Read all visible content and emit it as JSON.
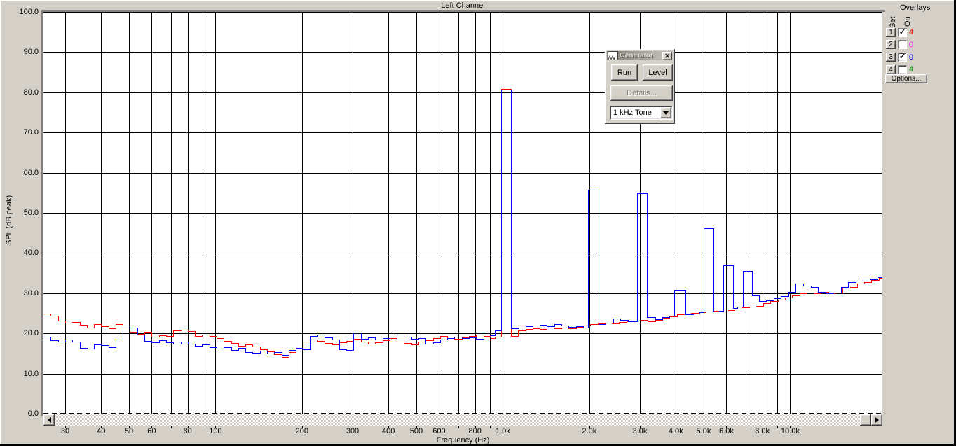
{
  "window": {
    "app_context": "audio spectrum analyzer"
  },
  "chart": {
    "title": "Left Channel",
    "xlabel": "Frequency (Hz)",
    "ylabel": "SPL (dB peak)"
  },
  "chart_data": {
    "type": "line",
    "subtype": "stepped-spectrum",
    "title": "Left Channel",
    "xlabel": "Frequency (Hz)",
    "ylabel": "SPL (dB peak)",
    "x_scale": "log",
    "x_range_hz": [
      25.2,
      20940
    ],
    "ylim": [
      0,
      100
    ],
    "grid": true,
    "grid_color": "#000000",
    "y_ticks": [
      {
        "v": 100,
        "label": "100.0"
      },
      {
        "v": 90,
        "label": "90.0"
      },
      {
        "v": 80,
        "label": "80.0"
      },
      {
        "v": 70,
        "label": "70.0"
      },
      {
        "v": 60,
        "label": "60.0"
      },
      {
        "v": 50,
        "label": "50.0"
      },
      {
        "v": 40,
        "label": "40.0"
      },
      {
        "v": 30,
        "label": "30.0"
      },
      {
        "v": 20,
        "label": "20.0"
      },
      {
        "v": 10,
        "label": "10.0"
      },
      {
        "v": 0,
        "label": "0.0"
      }
    ],
    "grid_freqs": [
      30,
      40,
      50,
      60,
      70,
      80,
      90,
      100,
      200,
      300,
      400,
      500,
      600,
      700,
      800,
      900,
      1000,
      2000,
      3000,
      4000,
      5000,
      6000,
      7000,
      8000,
      9000,
      10000
    ],
    "x_tick_labels": [
      {
        "f": 30,
        "label": "30"
      },
      {
        "f": 40,
        "label": "40"
      },
      {
        "f": 50,
        "label": "50"
      },
      {
        "f": 60,
        "label": "60"
      },
      {
        "f": 80,
        "label": "80"
      },
      {
        "f": 100,
        "label": "100"
      },
      {
        "f": 200,
        "label": "200"
      },
      {
        "f": 300,
        "label": "300"
      },
      {
        "f": 400,
        "label": "400"
      },
      {
        "f": 500,
        "label": "500"
      },
      {
        "f": 600,
        "label": "600"
      },
      {
        "f": 800,
        "label": "800"
      },
      {
        "f": 1000,
        "label": "1.0k"
      },
      {
        "f": 2000,
        "label": "2.0k"
      },
      {
        "f": 3000,
        "label": "3.0k"
      },
      {
        "f": 4000,
        "label": "4.0k"
      },
      {
        "f": 5000,
        "label": "5.0k"
      },
      {
        "f": 6000,
        "label": "6.0k"
      },
      {
        "f": 8000,
        "label": "8.0k"
      },
      {
        "f": 10000,
        "label": "10.0k"
      }
    ],
    "series": [
      {
        "name": "overlay-trace-red",
        "color": "#ff0000",
        "points": [
          [
            25.2,
            24.9
          ],
          [
            26.7,
            24.4
          ],
          [
            28.3,
            23.2
          ],
          [
            30,
            22.7
          ],
          [
            31.8,
            22.9
          ],
          [
            33.7,
            22.1
          ],
          [
            35.7,
            21.4
          ],
          [
            37.8,
            22.3
          ],
          [
            40,
            21.7
          ],
          [
            42.4,
            21.2
          ],
          [
            44.9,
            22.3
          ],
          [
            47.6,
            21.9
          ],
          [
            50.4,
            20.4
          ],
          [
            53.4,
            19.9
          ],
          [
            56.6,
            20.3
          ],
          [
            60,
            19.2
          ],
          [
            63.5,
            19.5
          ],
          [
            67.3,
            19.4
          ],
          [
            71.3,
            20.7
          ],
          [
            75.6,
            20.9
          ],
          [
            80.1,
            20.5
          ],
          [
            84.9,
            19.3
          ],
          [
            89.9,
            19.6
          ],
          [
            95.2,
            19.4
          ],
          [
            100.9,
            18.9
          ],
          [
            106.9,
            18.1
          ],
          [
            113.3,
            17.6
          ],
          [
            120,
            16.9
          ],
          [
            127.1,
            17.2
          ],
          [
            134.7,
            16.7
          ],
          [
            142.7,
            16.1
          ],
          [
            151.2,
            15.5
          ],
          [
            160.2,
            14.8
          ],
          [
            169.7,
            14.1
          ],
          [
            179.8,
            15.3
          ],
          [
            190.5,
            16.4
          ],
          [
            201.8,
            17.9
          ],
          [
            213.8,
            18.4
          ],
          [
            226.5,
            18.1
          ],
          [
            240,
            17.6
          ],
          [
            254.3,
            17.2
          ],
          [
            269.4,
            17.7
          ],
          [
            285.4,
            18.2
          ],
          [
            302.4,
            18.6
          ],
          [
            320.4,
            18
          ],
          [
            339.4,
            17.4
          ],
          [
            359.6,
            17.7
          ],
          [
            381,
            18.3
          ],
          [
            403.6,
            18.8
          ],
          [
            427.6,
            18.4
          ],
          [
            453.1,
            17.6
          ],
          [
            480,
            17.3
          ],
          [
            508.6,
            17.9
          ],
          [
            538.8,
            18.3
          ],
          [
            570.9,
            18.8
          ],
          [
            604.8,
            19.3
          ],
          [
            640.8,
            18.9
          ],
          [
            678.9,
            18.6
          ],
          [
            719.3,
            19
          ],
          [
            762.1,
            19.4
          ],
          [
            807.4,
            19.7
          ],
          [
            855.4,
            19.3
          ],
          [
            906.3,
            18.9
          ],
          [
            940,
            19.2
          ],
          [
            987,
            80.8
          ],
          [
            1068,
            19.3
          ],
          [
            1131,
            20.8
          ],
          [
            1198,
            21
          ],
          [
            1269,
            21.2
          ],
          [
            1345,
            21.1
          ],
          [
            1425,
            21.4
          ],
          [
            1510,
            21.2
          ],
          [
            1600,
            21.5
          ],
          [
            1695,
            21.3
          ],
          [
            1796,
            21.6
          ],
          [
            1903,
            22
          ],
          [
            2016,
            22.3
          ],
          [
            2136,
            22.4
          ],
          [
            2263,
            22.6
          ],
          [
            2398,
            22.5
          ],
          [
            2540,
            22.8
          ],
          [
            2691,
            23
          ],
          [
            2851,
            23.2
          ],
          [
            3021,
            23.3
          ],
          [
            3200,
            23
          ],
          [
            3391,
            23.4
          ],
          [
            3593,
            23.8
          ],
          [
            3806,
            24.3
          ],
          [
            4033,
            24.7
          ],
          [
            4272,
            25
          ],
          [
            4526,
            25.1
          ],
          [
            4796,
            25.3
          ],
          [
            5081,
            25.4
          ],
          [
            5383,
            25.6
          ],
          [
            5703,
            25.5
          ],
          [
            6042,
            25.8
          ],
          [
            6402,
            26.1
          ],
          [
            6782,
            26.4
          ],
          [
            7185,
            26.6
          ],
          [
            7613,
            26.9
          ],
          [
            8066,
            27.5
          ],
          [
            8545,
            28
          ],
          [
            9053,
            28.4
          ],
          [
            9592,
            28.9
          ],
          [
            10162,
            29.4
          ],
          [
            10767,
            29.9
          ],
          [
            11407,
            30.2
          ],
          [
            12085,
            30
          ],
          [
            12804,
            30.3
          ],
          [
            13565,
            29.9
          ],
          [
            14372,
            30.2
          ],
          [
            15227,
            31.3
          ],
          [
            16132,
            31.6
          ],
          [
            17092,
            32.4
          ],
          [
            18108,
            32.8
          ],
          [
            19185,
            33.2
          ],
          [
            20326,
            33.8
          ]
        ]
      },
      {
        "name": "live-trace-blue",
        "color": "#0000ff",
        "points": [
          [
            25.2,
            19.2
          ],
          [
            26.7,
            18.3
          ],
          [
            28.3,
            18
          ],
          [
            30,
            18.5
          ],
          [
            31.8,
            17.9
          ],
          [
            33.7,
            16.4
          ],
          [
            35.7,
            16.2
          ],
          [
            37.8,
            17.3
          ],
          [
            40,
            17
          ],
          [
            42.4,
            16.6
          ],
          [
            44.9,
            18.4
          ],
          [
            47.6,
            21.9
          ],
          [
            50.4,
            21.4
          ],
          [
            53.4,
            19.6
          ],
          [
            56.6,
            18.1
          ],
          [
            60,
            17.8
          ],
          [
            63.5,
            18.3
          ],
          [
            67.3,
            17.7
          ],
          [
            71.3,
            17.4
          ],
          [
            75.6,
            17.9
          ],
          [
            80.1,
            17.5
          ],
          [
            84.9,
            16.9
          ],
          [
            89.9,
            17.3
          ],
          [
            95.2,
            16.6
          ],
          [
            100.9,
            16.2
          ],
          [
            106.9,
            16.5
          ],
          [
            113.3,
            15.9
          ],
          [
            120,
            16.3
          ],
          [
            127.1,
            15.4
          ],
          [
            134.7,
            15.1
          ],
          [
            142.7,
            15.6
          ],
          [
            151.2,
            14.9
          ],
          [
            160.2,
            15.3
          ],
          [
            169.7,
            14.7
          ],
          [
            179.8,
            15.8
          ],
          [
            190.5,
            16.4
          ],
          [
            201.8,
            16.1
          ],
          [
            213.8,
            19.3
          ],
          [
            226.5,
            19.6
          ],
          [
            240,
            19
          ],
          [
            254.3,
            18.4
          ],
          [
            269.4,
            16.1
          ],
          [
            285.4,
            15.9
          ],
          [
            302.4,
            20.2
          ],
          [
            320.4,
            18.7
          ],
          [
            339.4,
            19
          ],
          [
            359.6,
            18.5
          ],
          [
            381,
            18.8
          ],
          [
            403.6,
            19.2
          ],
          [
            427.6,
            19.6
          ],
          [
            453.1,
            19.1
          ],
          [
            480,
            18.6
          ],
          [
            508.6,
            18.9
          ],
          [
            538.8,
            17.4
          ],
          [
            570.9,
            17.8
          ],
          [
            604.8,
            18.4
          ],
          [
            640.8,
            18.8
          ],
          [
            678.9,
            19.1
          ],
          [
            719.3,
            18.8
          ],
          [
            762.1,
            19
          ],
          [
            807.4,
            18.7
          ],
          [
            855.4,
            19.2
          ],
          [
            906.3,
            19.5
          ],
          [
            940,
            20.7
          ],
          [
            987,
            80.7
          ],
          [
            1068,
            21.2
          ],
          [
            1131,
            21.4
          ],
          [
            1198,
            21.7
          ],
          [
            1269,
            21.5
          ],
          [
            1345,
            22.1
          ],
          [
            1425,
            21.8
          ],
          [
            1510,
            22.3
          ],
          [
            1600,
            21.9
          ],
          [
            1695,
            21.6
          ],
          [
            1796,
            21.8
          ],
          [
            1903,
            21.5
          ],
          [
            1980,
            55.8
          ],
          [
            2150,
            22.3
          ],
          [
            2280,
            22.6
          ],
          [
            2420,
            23.7
          ],
          [
            2560,
            23.3
          ],
          [
            2720,
            23
          ],
          [
            2940,
            54.9
          ],
          [
            3180,
            24
          ],
          [
            3390,
            23.6
          ],
          [
            3590,
            24
          ],
          [
            3800,
            24.4
          ],
          [
            3950,
            30.8
          ],
          [
            4330,
            24.7
          ],
          [
            4590,
            25
          ],
          [
            4840,
            25.2
          ],
          [
            5000,
            46.2
          ],
          [
            5410,
            25.4
          ],
          [
            5670,
            25.6
          ],
          [
            5850,
            36.9
          ],
          [
            6330,
            26.3
          ],
          [
            6550,
            26.6
          ],
          [
            6860,
            35.5
          ],
          [
            7370,
            29.4
          ],
          [
            7800,
            28
          ],
          [
            8250,
            28.3
          ],
          [
            8750,
            28.7
          ],
          [
            9300,
            29.3
          ],
          [
            9850,
            30.3
          ],
          [
            10450,
            32.4
          ],
          [
            11100,
            31.8
          ],
          [
            11800,
            31.6
          ],
          [
            12500,
            30.3
          ],
          [
            13300,
            30
          ],
          [
            14100,
            30.2
          ],
          [
            15000,
            31.5
          ],
          [
            15900,
            32.7
          ],
          [
            16900,
            33.1
          ],
          [
            17900,
            33.6
          ],
          [
            19000,
            33.5
          ],
          [
            20100,
            33.9
          ]
        ]
      }
    ]
  },
  "generator_dialog": {
    "title": "Generator",
    "run_label": "Run",
    "level_label": "Level",
    "details_label": "Details...",
    "details_enabled": false,
    "signal_select_value": "1 kHz Tone",
    "close_glyph": "✕"
  },
  "overlays_panel": {
    "title": "Overlays",
    "col_set": "Set",
    "col_on": "On",
    "rows": [
      {
        "set_label": "1",
        "checked": true,
        "count": "4",
        "color": "#ff0000"
      },
      {
        "set_label": "2",
        "checked": false,
        "count": "0",
        "color": "#ff00ff"
      },
      {
        "set_label": "3",
        "checked": true,
        "count": "0",
        "color": "#0000ff"
      },
      {
        "set_label": "4",
        "checked": false,
        "count": "4",
        "color": "#009900"
      }
    ],
    "options_label": "Options...",
    "check_glyph": "✓"
  },
  "colors": {
    "background": "#d4d0c8",
    "plot_background": "#ffffff",
    "grid": "#000000",
    "trace_red": "#ff0000",
    "trace_blue": "#0000ff"
  }
}
